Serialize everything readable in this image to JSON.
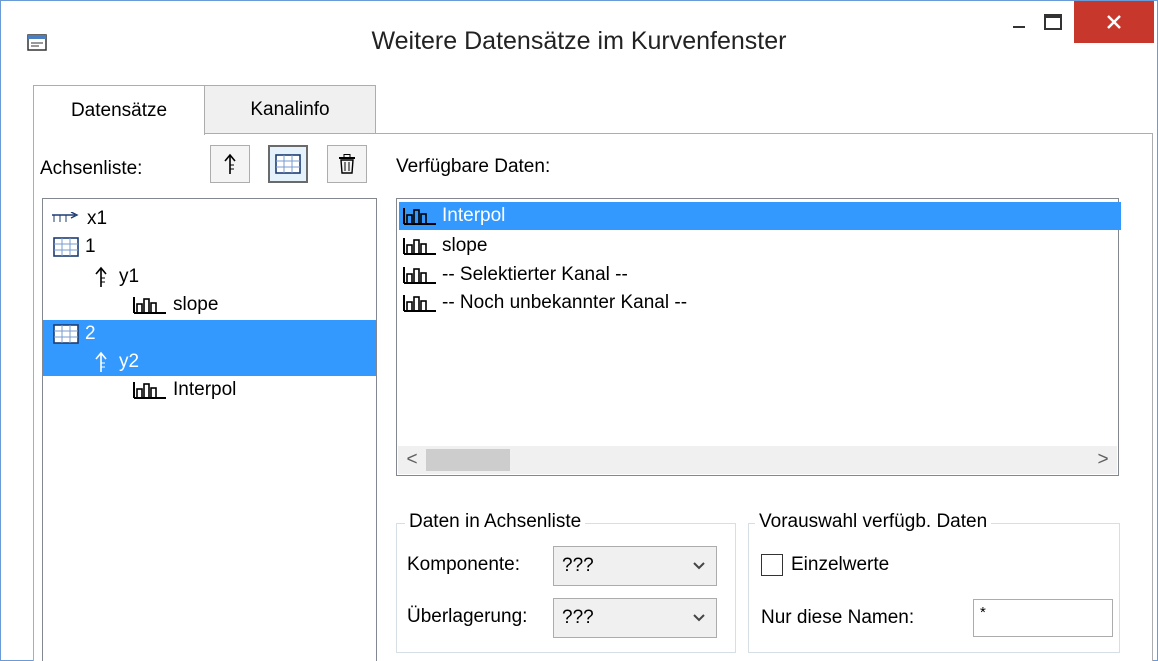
{
  "window": {
    "title": "Weitere Datensätze im Kurvenfenster",
    "controls": [
      "minimize",
      "maximize",
      "close"
    ]
  },
  "tabs": [
    {
      "label": "Datensätze",
      "active": true
    },
    {
      "label": "Kanalinfo",
      "active": false
    }
  ],
  "achsenliste": {
    "label": "Achsenliste:",
    "toolbar": [
      {
        "icon": "axis-arrow-icon"
      },
      {
        "icon": "grid-frame-icon",
        "pressed": true
      },
      {
        "icon": "trash-icon"
      }
    ],
    "tree": [
      {
        "icon": "x-axis-ruler-icon",
        "label": "x1",
        "level": 0,
        "selected": false
      },
      {
        "icon": "grid-frame-icon",
        "label": "1",
        "level": 0,
        "selected": false
      },
      {
        "icon": "axis-arrow-icon",
        "label": "y1",
        "level": 1,
        "selected": false
      },
      {
        "icon": "bar-chart-icon",
        "label": "slope",
        "level": 2,
        "selected": false
      },
      {
        "icon": "grid-frame-icon",
        "label": "2",
        "level": 0,
        "selected": true
      },
      {
        "icon": "axis-arrow-icon",
        "label": "y2",
        "level": 1,
        "selected": true
      },
      {
        "icon": "bar-chart-icon",
        "label": "Interpol",
        "level": 2,
        "selected": false
      }
    ]
  },
  "verfuegbar": {
    "label": "Verfügbare Daten:",
    "items": [
      {
        "icon": "bar-chart-icon",
        "label": "Interpol",
        "selected": true
      },
      {
        "icon": "bar-chart-icon",
        "label": "slope",
        "selected": false
      },
      {
        "icon": "bar-chart-icon",
        "label": "-- Selektierter Kanal --",
        "selected": false
      },
      {
        "icon": "bar-chart-icon",
        "label": "-- Noch unbekannter Kanal --",
        "selected": false
      }
    ],
    "scroll_left": "<",
    "scroll_right": ">"
  },
  "daten_group": {
    "legend": "Daten in Achsenliste",
    "komponente_label": "Komponente:",
    "komponente_value": "???",
    "ueberlagerung_label": "Überlagerung:",
    "ueberlagerung_value": "???"
  },
  "vorauswahl_group": {
    "legend": "Vorauswahl verfügb. Daten",
    "einzelwerte_label": "Einzelwerte",
    "einzelwerte_checked": false,
    "namen_label": "Nur diese Namen:",
    "namen_value": "*"
  },
  "colors": {
    "selection": "#3399ff",
    "close_button": "#c7372c"
  }
}
